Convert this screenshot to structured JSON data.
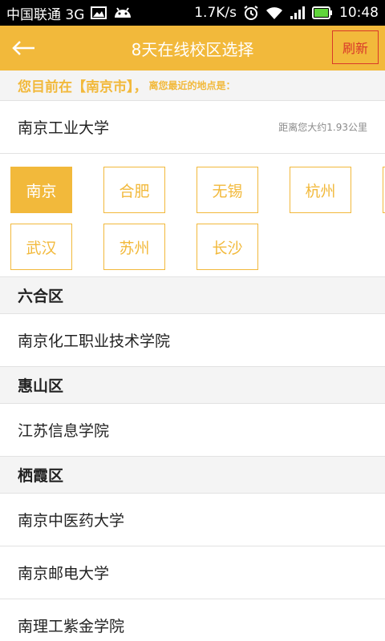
{
  "statusbar": {
    "carrier": "中国联通 3G",
    "net_speed": "1.7K/s",
    "time": "10:48"
  },
  "header": {
    "title": "8天在线校区选择",
    "refresh_label": "刷新"
  },
  "location": {
    "prefix": "您目前在【",
    "city": "南京市",
    "bracket_close": "】，",
    "suffix": "离您最近的地点是："
  },
  "nearest": {
    "name": "南京工业大学",
    "distance": "距离您大约1.93公里"
  },
  "cities": [
    {
      "label": "南京",
      "active": true
    },
    {
      "label": "合肥",
      "active": false
    },
    {
      "label": "无锡",
      "active": false
    },
    {
      "label": "杭州",
      "active": false
    },
    {
      "label": "武汉",
      "active": false
    },
    {
      "label": "苏州",
      "active": false
    },
    {
      "label": "长沙",
      "active": false
    }
  ],
  "districts": [
    {
      "name": "六合区",
      "schools": [
        "南京化工职业技术学院"
      ]
    },
    {
      "name": "惠山区",
      "schools": [
        "江苏信息学院"
      ]
    },
    {
      "name": "栖霞区",
      "schools": [
        "南京中医药大学",
        "南京邮电大学",
        "南理工紫金学院"
      ]
    }
  ],
  "colors": {
    "accent": "#f2b93b",
    "refresh_border": "#d9382a",
    "section_bg": "#f4f4f4"
  }
}
